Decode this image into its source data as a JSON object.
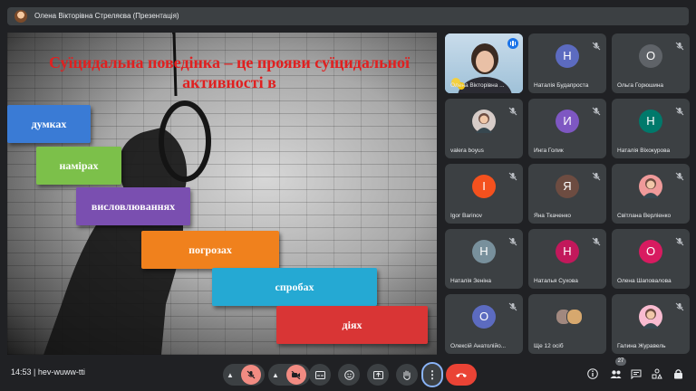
{
  "window": {
    "title": "Олена Вікторівна Стреляєва (Презентація)"
  },
  "slide": {
    "title": "Суїцидальна поведінка – це прояви суїцидальної активності в",
    "steps": [
      {
        "label": "думках",
        "color": "#3a7bd5"
      },
      {
        "label": "намірах",
        "color": "#7cc04a"
      },
      {
        "label": "висловлюваннях",
        "color": "#7a4fb0"
      },
      {
        "label": "погрозах",
        "color": "#f0811d"
      },
      {
        "label": "спробах",
        "color": "#25a9d3"
      },
      {
        "label": "діях",
        "color": "#d93535"
      }
    ]
  },
  "participants": [
    {
      "name": "Олена Вікторівна ...",
      "initial": "",
      "color": "",
      "video": true
    },
    {
      "name": "Наталія Будапроста",
      "initial": "Н",
      "color": "#5c6bc0"
    },
    {
      "name": "Ольга Горюшина",
      "initial": "О",
      "color": "#5f6368"
    },
    {
      "name": "valera boyus",
      "initial": "",
      "color": "#d7ccc8",
      "photo": true
    },
    {
      "name": "Инга Голик",
      "initial": "И",
      "color": "#7e57c2"
    },
    {
      "name": "Наталія Віхокурова",
      "initial": "Н",
      "color": "#00796b"
    },
    {
      "name": "Igor Barinov",
      "initial": "I",
      "color": "#f4511e"
    },
    {
      "name": "Яна Ткаченко",
      "initial": "Я",
      "color": "#6d4c41"
    },
    {
      "name": "Світлана Верліенко",
      "initial": "",
      "color": "#ef9a9a",
      "photo": true
    },
    {
      "name": "Наталія Зеніна",
      "initial": "Н",
      "color": "#78909c"
    },
    {
      "name": "Наталья Сухова",
      "initial": "Н",
      "color": "#c2185b"
    },
    {
      "name": "Олена Шаповалова",
      "initial": "О",
      "color": "#d81b60"
    },
    {
      "name": "Олексій Анатолійо...",
      "initial": "О",
      "color": "#5c6bc0"
    },
    {
      "name": "Ще 12 осіб",
      "initial": "",
      "color": "",
      "more": true
    },
    {
      "name": "Галина Журавель",
      "initial": "",
      "color": "#f8bbd0",
      "photo": true
    }
  ],
  "bottom": {
    "time": "14:53",
    "separator": "|",
    "meeting_code": "hev-wuww-tti",
    "participant_count": "27"
  },
  "icons": {
    "mic": "mic-off-icon",
    "camera": "camera-off-icon",
    "captions": "captions-icon",
    "emoji": "emoji-icon",
    "present": "present-icon",
    "hand": "raise-hand-icon",
    "more": "more-vert-icon",
    "hangup": "hangup-icon",
    "info": "info-icon",
    "people": "people-icon",
    "chat": "chat-icon",
    "activities": "activities-icon",
    "lock": "host-controls-icon"
  },
  "colors": {
    "background": "#202124",
    "tile": "#3c4043",
    "hangup": "#ea4335",
    "focus": "#8ab4f8"
  }
}
